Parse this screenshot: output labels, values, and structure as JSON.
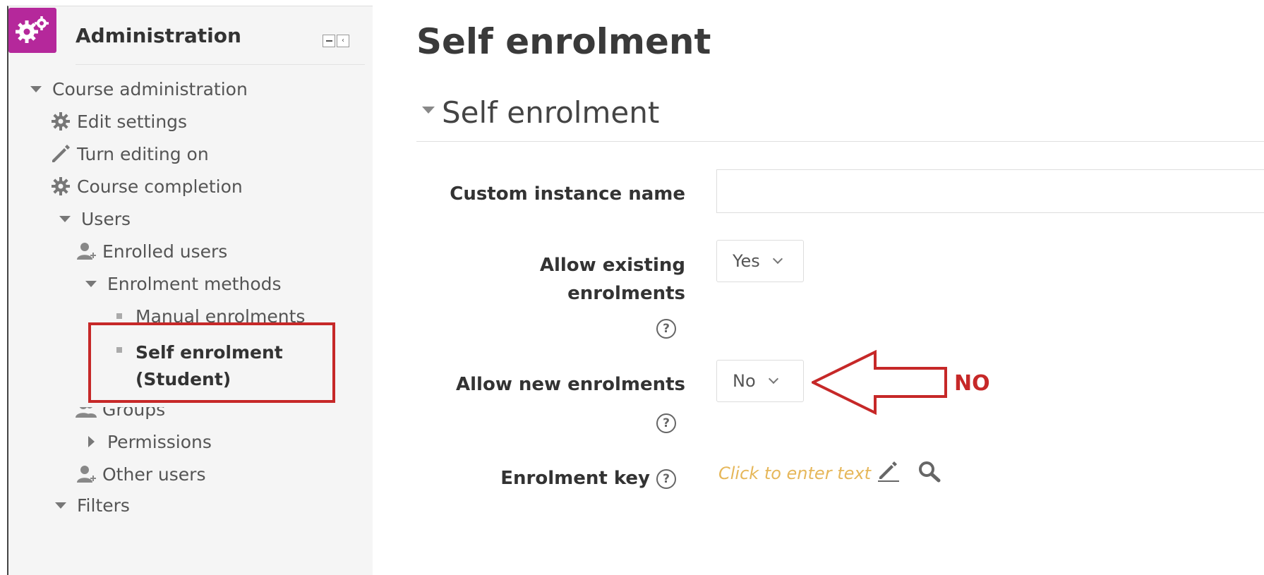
{
  "sidebar": {
    "title": "Administration",
    "items": [
      {
        "label": "Course administration",
        "icon": "triangle-down-icon"
      },
      {
        "label": "Edit settings",
        "icon": "gear-icon"
      },
      {
        "label": "Turn editing on",
        "icon": "pencil-icon"
      },
      {
        "label": "Course completion",
        "icon": "gear-icon"
      },
      {
        "label": "Users",
        "icon": "triangle-down-icon"
      },
      {
        "label": "Enrolled users",
        "icon": "user-icon"
      },
      {
        "label": "Enrolment methods",
        "icon": "triangle-down-icon"
      },
      {
        "label": "Manual enrolments",
        "icon": "bullet-icon"
      },
      {
        "label_line1": "Self enrolment",
        "label_line2": "(Student)",
        "icon": "bullet-icon"
      },
      {
        "label": "Groups",
        "icon": "group-icon"
      },
      {
        "label": "Permissions",
        "icon": "triangle-right-icon"
      },
      {
        "label": "Other users",
        "icon": "user-icon"
      },
      {
        "label": "Filters",
        "icon": "triangle-down-icon"
      }
    ]
  },
  "main": {
    "page_title": "Self enrolment",
    "section_title": "Self enrolment",
    "fields": {
      "custom_name": {
        "label": "Custom instance name",
        "value": ""
      },
      "allow_existing": {
        "label_line1": "Allow existing",
        "label_line2": "enrolments",
        "value": "Yes"
      },
      "allow_new": {
        "label": "Allow new enrolments",
        "value": "No"
      },
      "enrolment_key": {
        "label": "Enrolment key",
        "placeholder": "Click to enter text"
      }
    },
    "annotation": "NO"
  },
  "colors": {
    "highlight": "#c62828",
    "block_icon": "#b5289b",
    "inline_edit": "#e6b75a"
  }
}
